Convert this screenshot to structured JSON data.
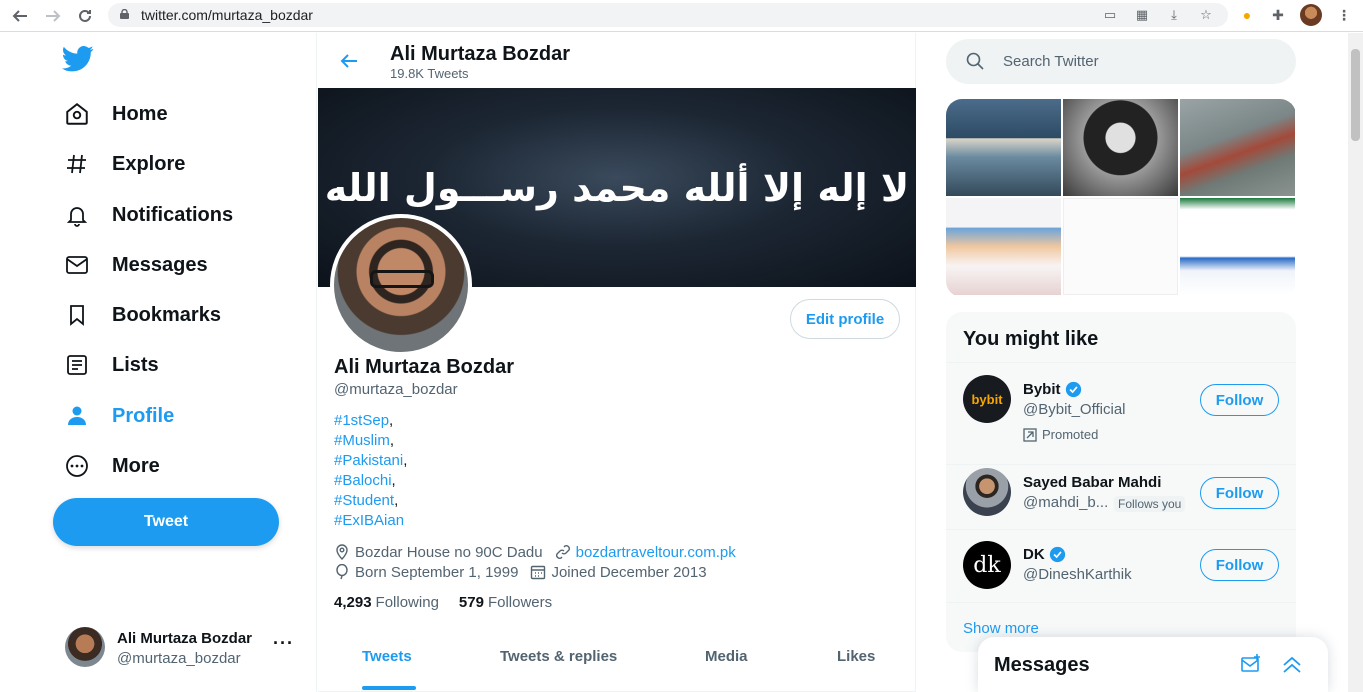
{
  "browser": {
    "url": "twitter.com/murtaza_bozdar"
  },
  "nav": {
    "items": [
      {
        "label": "Home",
        "icon": "home-icon"
      },
      {
        "label": "Explore",
        "icon": "hashtag-icon"
      },
      {
        "label": "Notifications",
        "icon": "bell-icon"
      },
      {
        "label": "Messages",
        "icon": "mail-icon"
      },
      {
        "label": "Bookmarks",
        "icon": "bookmark-icon"
      },
      {
        "label": "Lists",
        "icon": "list-icon"
      },
      {
        "label": "Profile",
        "icon": "user-icon",
        "active": true
      },
      {
        "label": "More",
        "icon": "more-circle-icon"
      }
    ],
    "tweet_button": "Tweet"
  },
  "account": {
    "name": "Ali Murtaza Bozdar",
    "handle": "@murtaza_bozdar",
    "menu": "···"
  },
  "profile": {
    "header_name": "Ali Murtaza Bozdar",
    "tweet_count": "19.8K Tweets",
    "banner_text": "لا إله إلا ألله محمد رســـول الله",
    "edit_button": "Edit profile",
    "name": "Ali Murtaza Bozdar",
    "handle": "@murtaza_bozdar",
    "bio": [
      {
        "tag": "#1stSep",
        "sep": ","
      },
      {
        "tag": "#Muslim",
        "sep": ","
      },
      {
        "tag": "#Pakistani",
        "sep": ","
      },
      {
        "tag": "#Balochi",
        "sep": ","
      },
      {
        "tag": "#Student",
        "sep": ","
      },
      {
        "tag": "#ExIBAian",
        "sep": ""
      }
    ],
    "location": "Bozdar House no 90C Dadu",
    "website": "bozdartraveltour.com.pk",
    "birthday": "Born September 1, 1999",
    "joined": "Joined December 2013",
    "following_count": "4,293",
    "following_label": "Following",
    "followers_count": "579",
    "followers_label": "Followers",
    "tabs": [
      "Tweets",
      "Tweets & replies",
      "Media",
      "Likes"
    ]
  },
  "search": {
    "placeholder": "Search Twitter"
  },
  "suggestions": {
    "title": "You might like",
    "users": [
      {
        "name": "Bybit",
        "handle": "@Bybit_Official",
        "verified": true,
        "promoted": "Promoted",
        "button": "Follow"
      },
      {
        "name": "Sayed Babar Mahdi",
        "handle": "@mahdi_b...",
        "follows_you": "Follows you",
        "button": "Follow"
      },
      {
        "name": "DK",
        "handle": "@DineshKarthik",
        "verified": true,
        "button": "Follow"
      }
    ],
    "show_more": "Show more"
  },
  "messages_drawer": {
    "title": "Messages"
  },
  "colors": {
    "accent": "#1d9bf0",
    "text": "#0f1419",
    "secondary": "#536471"
  }
}
